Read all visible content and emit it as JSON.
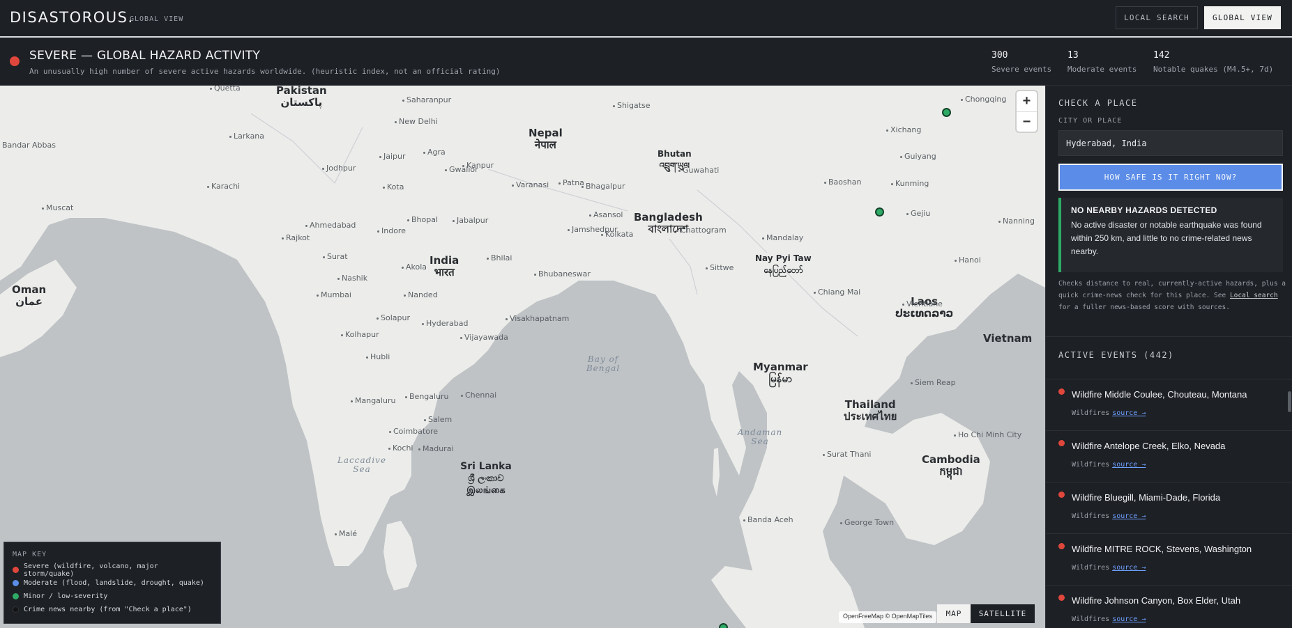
{
  "header": {
    "brand": "DISASTOROUS.",
    "subtitle": "GLOBAL VIEW",
    "nav": {
      "local_search": "LOCAL SEARCH",
      "global_view": "GLOBAL VIEW"
    }
  },
  "status": {
    "level_color": "#e0473c",
    "title": "SEVERE — GLOBAL HAZARD ACTIVITY",
    "description": "An unusually high number of severe active hazards worldwide. (heuristic index, not an official rating)",
    "stats": [
      {
        "value": "300",
        "label": "Severe events"
      },
      {
        "value": "13",
        "label": "Moderate events"
      },
      {
        "value": "142",
        "label": "Notable quakes (M4.5+, 7d)"
      }
    ]
  },
  "map": {
    "zoom_in": "+",
    "zoom_out": "−",
    "countries": [
      {
        "name": "Pakistan",
        "native": "پاکستان"
      },
      {
        "name": "Nepal",
        "native": "नेपाल"
      },
      {
        "name": "Bhutan",
        "native": "འབྲུག་ཡུལ"
      },
      {
        "name": "India",
        "native": "भारत"
      },
      {
        "name": "Bangladesh",
        "native": "বাংলাদেশ"
      },
      {
        "name": "Oman",
        "native": "عمان"
      },
      {
        "name": "Myanmar",
        "native": "မြန်မာ"
      },
      {
        "name": "Laos",
        "native": "ປະເທດລາວ"
      },
      {
        "name": "Thailand",
        "native": "ประเทศไทย"
      },
      {
        "name": "Cambodia",
        "native": "កម្ពុជា"
      },
      {
        "name": "Vietnam",
        "native": ""
      },
      {
        "name": "Sri Lanka",
        "native": "ශ්‍රී ලංකාව இலங்கை"
      },
      {
        "name": "Nay Pyi Taw",
        "native": "နေပြည်တော်"
      }
    ],
    "cities": [
      "Quetta",
      "Saharanpur",
      "Shigatse",
      "Chongqing",
      "New Delhi",
      "Larkana",
      "Xichang",
      "Bandar Abbas",
      "Agra",
      "Jaipur",
      "Gwalior",
      "Kanpur",
      "Jodhpur",
      "Guiyang",
      "Guwahati",
      "Karachi",
      "Kota",
      "Varanasi",
      "Patna",
      "Bhagalpur",
      "Baoshan",
      "Kunming",
      "Muscat",
      "Gejiu",
      "Asansol",
      "Ahmedabad",
      "Bhopal",
      "Jabalpur",
      "Nanning",
      "Indore",
      "Jamshedpur",
      "Rajkot",
      "Kolkata",
      "Chattogram",
      "Mandalay",
      "Surat",
      "Bhilai",
      "Hanoi",
      "Akola",
      "Sittwe",
      "Nashik",
      "Bhubaneswar",
      "Chiang Mai",
      "Mumbai",
      "Nanded",
      "Vientiane",
      "Solapur",
      "Hyderabad",
      "Visakhapatnam",
      "Kolhapur",
      "Vijayawada",
      "Hubli",
      "Siem Reap",
      "Mangaluru",
      "Bengaluru",
      "Chennai",
      "Salem",
      "Coimbatore",
      "Ho Chi Minh City",
      "Kochi",
      "Madurai",
      "Surat Thani",
      "Banda Aceh",
      "George Town",
      "Malé"
    ],
    "seas": [
      {
        "name": "Bay of Bengal"
      },
      {
        "name": "Andaman Sea"
      },
      {
        "name": "Laccadive Sea"
      }
    ],
    "markers": [
      {
        "severity": "minor",
        "color": "#2eaa66"
      },
      {
        "severity": "minor",
        "color": "#2eaa66"
      },
      {
        "severity": "minor",
        "color": "#2eaa66"
      }
    ],
    "legend": {
      "title": "MAP KEY",
      "items": [
        {
          "color": "#e0473c",
          "label": "Severe (wildfire, volcano, major storm/quake)"
        },
        {
          "color": "#5b8de8",
          "label": "Moderate (flood, landslide, drought, quake)"
        },
        {
          "color": "#2eaa66",
          "label": "Minor / low-severity"
        },
        {
          "color": "#111316",
          "label": "Crime news nearby (from \"Check a place\")"
        }
      ]
    },
    "attribution": "OpenFreeMap © OpenMapTiles",
    "toggle": {
      "map": "MAP",
      "satellite": "SATELLITE",
      "selected": "MAP"
    }
  },
  "sidebar": {
    "check_title": "CHECK A PLACE",
    "field_label": "CITY OR PLACE",
    "place_value": "Hyderabad, India",
    "button_label": "HOW SAFE IS IT RIGHT NOW?",
    "result": {
      "title": "NO NEARBY HAZARDS DETECTED",
      "body": "No active disaster or notable earthquake was found within 250 km, and little to no crime-related news nearby."
    },
    "note_pre": "Checks distance to real, currently-active hazards, plus a quick crime-news check for this place. See",
    "note_link": "Local search",
    "note_post": "for a fuller news-based score with sources.",
    "events_title": "ACTIVE EVENTS (442)",
    "events": [
      {
        "name": "Wildfire Middle Coulee, Chouteau, Montana",
        "type": "Wildfires",
        "link": "source →"
      },
      {
        "name": "Wildfire Antelope Creek, Elko, Nevada",
        "type": "Wildfires",
        "link": "source →"
      },
      {
        "name": "Wildfire Bluegill, Miami-Dade, Florida",
        "type": "Wildfires",
        "link": "source →"
      },
      {
        "name": "Wildfire MITRE ROCK, Stevens, Washington",
        "type": "Wildfires",
        "link": "source →"
      },
      {
        "name": "Wildfire Johnson Canyon, Box Elder, Utah",
        "type": "Wildfires",
        "link": "source →"
      }
    ]
  }
}
